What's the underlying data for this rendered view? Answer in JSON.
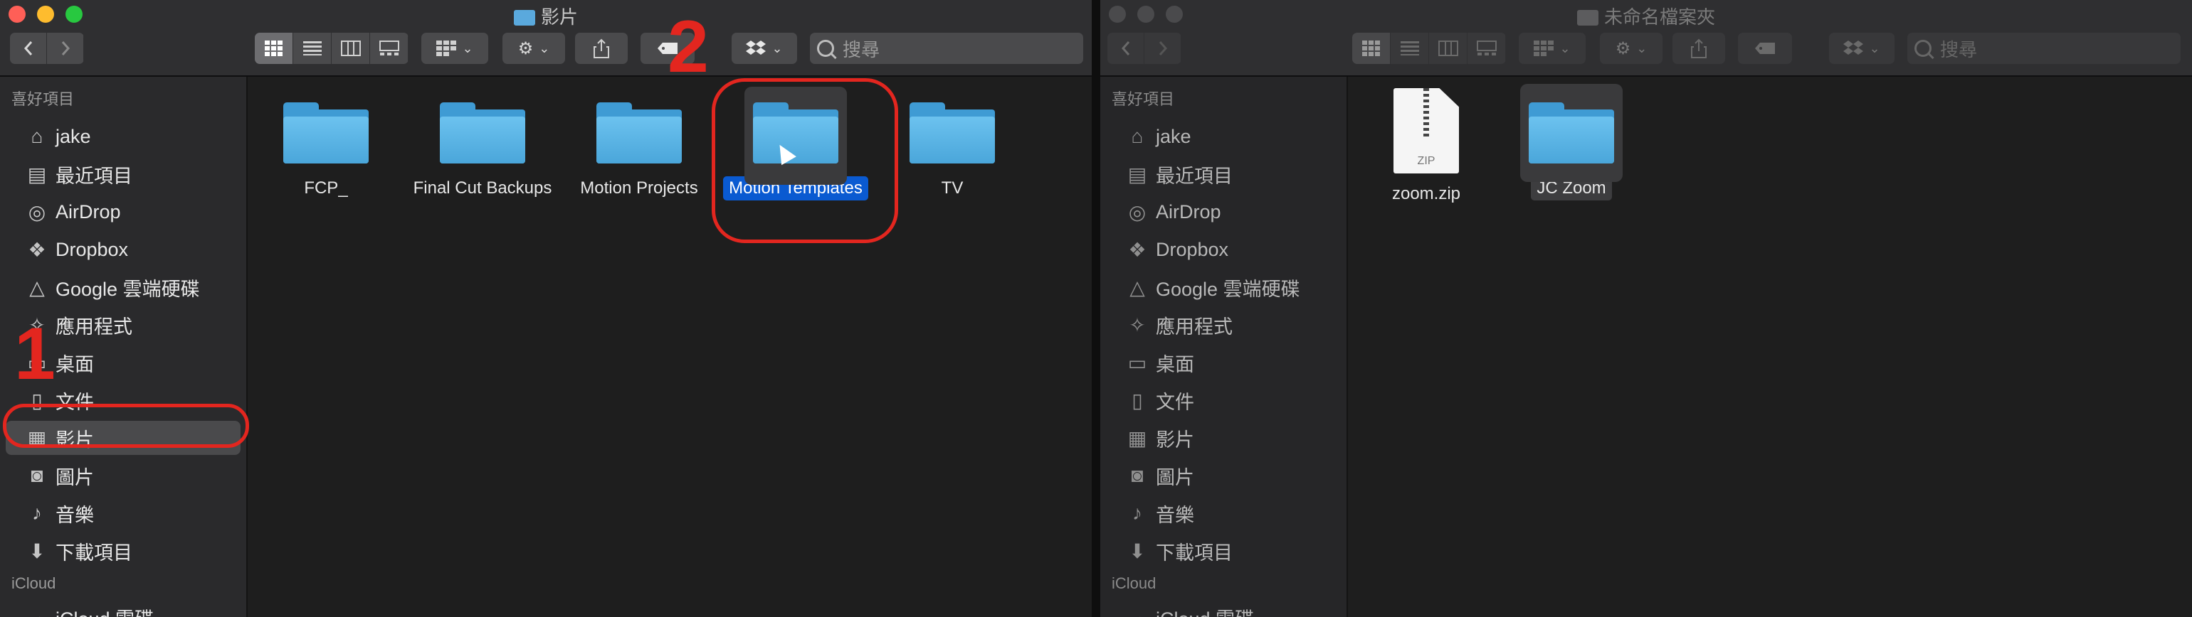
{
  "left_window": {
    "title": "影片",
    "toolbar": {
      "search_placeholder": "搜尋"
    },
    "sidebar": {
      "favorites_title": "喜好項目",
      "items": [
        {
          "label": "jake",
          "icon": "home-icon"
        },
        {
          "label": "最近項目",
          "icon": "recents-icon"
        },
        {
          "label": "AirDrop",
          "icon": "airdrop-icon"
        },
        {
          "label": "Dropbox",
          "icon": "dropbox-icon"
        },
        {
          "label": "Google 雲端硬碟",
          "icon": "google-drive-icon"
        },
        {
          "label": "應用程式",
          "icon": "applications-icon"
        },
        {
          "label": "桌面",
          "icon": "desktop-icon"
        },
        {
          "label": "文件",
          "icon": "documents-icon"
        },
        {
          "label": "影片",
          "icon": "movies-icon",
          "selected": true
        },
        {
          "label": "圖片",
          "icon": "pictures-icon"
        },
        {
          "label": "音樂",
          "icon": "music-icon"
        },
        {
          "label": "下載項目",
          "icon": "downloads-icon"
        }
      ],
      "icloud_title": "iCloud",
      "icloud_item": "iCloud 雲碟"
    },
    "files": [
      {
        "name": "FCP_",
        "kind": "folder"
      },
      {
        "name": "Final Cut Backups",
        "kind": "folder"
      },
      {
        "name": "Motion Projects",
        "kind": "folder"
      },
      {
        "name": "Motion Templates",
        "kind": "folder",
        "selected": true
      },
      {
        "name": "TV",
        "kind": "folder"
      }
    ]
  },
  "right_window": {
    "title": "未命名檔案夾",
    "toolbar": {
      "search_placeholder": "搜尋"
    },
    "sidebar": {
      "favorites_title": "喜好項目",
      "items": [
        {
          "label": "jake",
          "icon": "home-icon"
        },
        {
          "label": "最近項目",
          "icon": "recents-icon"
        },
        {
          "label": "AirDrop",
          "icon": "airdrop-icon"
        },
        {
          "label": "Dropbox",
          "icon": "dropbox-icon"
        },
        {
          "label": "Google 雲端硬碟",
          "icon": "google-drive-icon"
        },
        {
          "label": "應用程式",
          "icon": "applications-icon"
        },
        {
          "label": "桌面",
          "icon": "desktop-icon"
        },
        {
          "label": "文件",
          "icon": "documents-icon"
        },
        {
          "label": "影片",
          "icon": "movies-icon"
        },
        {
          "label": "圖片",
          "icon": "pictures-icon"
        },
        {
          "label": "音樂",
          "icon": "music-icon"
        },
        {
          "label": "下載項目",
          "icon": "downloads-icon"
        }
      ],
      "icloud_title": "iCloud",
      "icloud_item": "iCloud 雲碟"
    },
    "files": [
      {
        "name": "zoom.zip",
        "kind": "zip",
        "badge": "ZIP"
      },
      {
        "name": "JC Zoom",
        "kind": "folder",
        "selected": true
      }
    ]
  },
  "annotations": {
    "step1": "1",
    "step2": "2",
    "color": "#e3261f"
  },
  "colors": {
    "selection": "#0a5ad1",
    "folder": "#4aa6da"
  }
}
